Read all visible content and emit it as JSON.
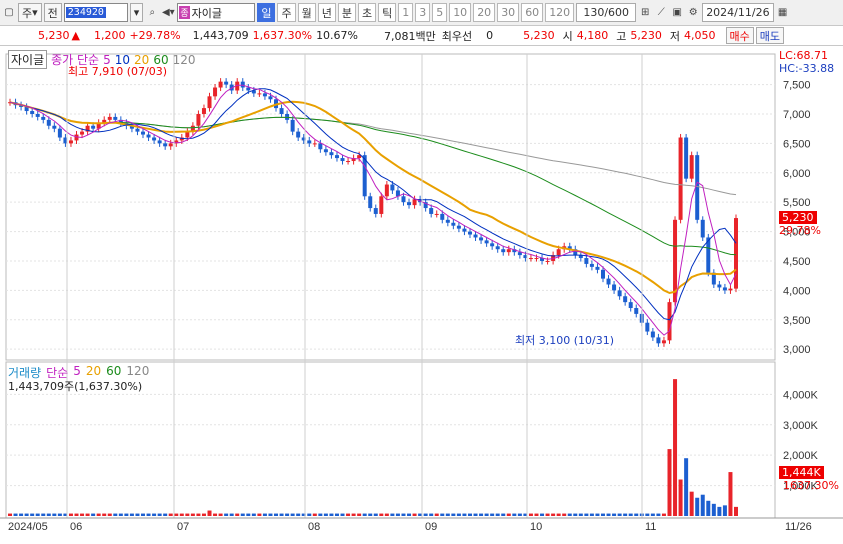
{
  "toolbar": {
    "type_label": "주",
    "prev_label": "전",
    "code": "234920",
    "name_tag": "종",
    "name": "자이글",
    "periods": [
      "일",
      "주",
      "월",
      "년",
      "분",
      "초",
      "틱"
    ],
    "numbers": [
      "1",
      "3",
      "5",
      "10",
      "20",
      "30",
      "60",
      "120"
    ],
    "count": "130/600",
    "date": "2024/11/26"
  },
  "quote": {
    "price": "5,230",
    "change": "1,200",
    "change_pct": "+29.78%",
    "volume": "1,443,709",
    "volume_pct": "1,637.30%",
    "turnover": "10.67%",
    "amount": "7,081백만",
    "pref_label": "최우선",
    "pref_value": "0",
    "pref_price": "5,230",
    "open_label": "시",
    "open": "4,180",
    "high_label": "고",
    "high": "5,230",
    "low_label": "저",
    "low": "4,050",
    "buy_label": "매수",
    "sell_label": "매도"
  },
  "chart_data": [
    {
      "type": "candlestick",
      "title": "자이글",
      "legend": {
        "prefix": "종가 단순",
        "items": [
          "5",
          "10",
          "20",
          "60",
          "120"
        ]
      },
      "y_ticks": [
        3000,
        3500,
        4000,
        4500,
        5000,
        5500,
        6000,
        6500,
        7000,
        7500
      ],
      "y_tick_labels": [
        "3,000",
        "3,500",
        "4,000",
        "4,500",
        "5,000",
        "5,500",
        "6,000",
        "6,500",
        "7,000",
        "7,500"
      ],
      "ylim": [
        2850,
        7850
      ],
      "annotations": {
        "max": "최고 7,910 (07/03)",
        "min": "최저 3,100 (10/31)",
        "lc": "LC:68.71",
        "hc": "HC:-33.88",
        "last_price": "5,230",
        "last_pct": "29.78%"
      },
      "close": [
        7200,
        7150,
        7120,
        7050,
        7000,
        6950,
        6900,
        6800,
        6750,
        6600,
        6500,
        6550,
        6650,
        6700,
        6800,
        6750,
        6850,
        6900,
        6950,
        6900,
        6850,
        6800,
        6750,
        6700,
        6650,
        6600,
        6550,
        6500,
        6450,
        6500,
        6550,
        6600,
        6700,
        6800,
        7000,
        7100,
        7300,
        7450,
        7550,
        7500,
        7400,
        7550,
        7450,
        7400,
        7350,
        7350,
        7300,
        7250,
        7100,
        7000,
        6900,
        6700,
        6600,
        6550,
        6500,
        6500,
        6400,
        6350,
        6300,
        6250,
        6200,
        6200,
        6250,
        6300,
        5600,
        5400,
        5300,
        5600,
        5800,
        5700,
        5600,
        5500,
        5450,
        5550,
        5500,
        5400,
        5300,
        5300,
        5200,
        5150,
        5100,
        5050,
        5000,
        4950,
        4900,
        4850,
        4800,
        4750,
        4700,
        4650,
        4700,
        4650,
        4600,
        4550,
        4550,
        4550,
        4500,
        4500,
        4600,
        4700,
        4750,
        4700,
        4600,
        4550,
        4450,
        4400,
        4350,
        4200,
        4100,
        4000,
        3900,
        3800,
        3700,
        3600,
        3450,
        3300,
        3200,
        3100,
        3150,
        3800,
        5200,
        6600,
        5900,
        6300,
        5200,
        4900,
        4300,
        4100,
        4050,
        4000,
        4030,
        5230
      ],
      "ma_label_series": [
        "5",
        "10",
        "20",
        "60",
        "120"
      ]
    },
    {
      "type": "bar",
      "title": "거래량",
      "legend": {
        "prefix": "단순",
        "items": [
          "5",
          "20",
          "60",
          "120"
        ]
      },
      "summary": "1,443,709주(1,637.30%)",
      "y_tick_labels": [
        "1,000K",
        "2,000K",
        "3,000K",
        "4,000K"
      ],
      "y_ticks": [
        1000,
        2000,
        3000,
        4000
      ],
      "ylim": [
        0,
        4800
      ],
      "last_value": "1,444K",
      "last_pct": "1637.30%",
      "x_tick_labels": [
        "2024/05",
        "06",
        "07",
        "08",
        "09",
        "10",
        "11",
        "11/26"
      ]
    }
  ]
}
